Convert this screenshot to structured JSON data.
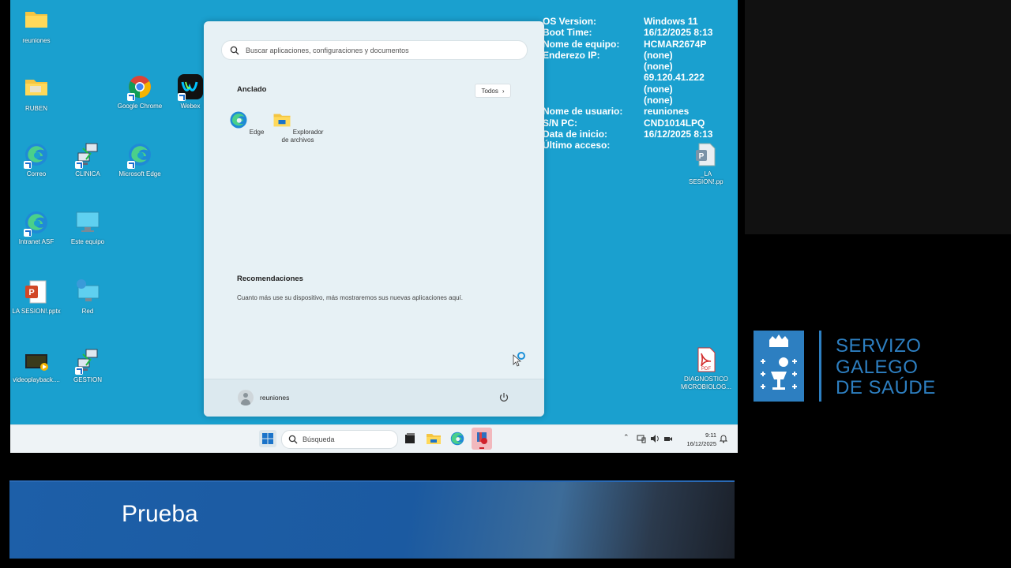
{
  "desktop": {
    "icons": [
      {
        "label": "reuniones",
        "icon": "folder-icon"
      },
      {
        "label": "RUBEN",
        "icon": "folder-icon"
      },
      {
        "label": "Google Chrome",
        "icon": "chrome-icon"
      },
      {
        "label": "Webex",
        "icon": "webex-icon"
      },
      {
        "label": "Correo",
        "icon": "edge-icon"
      },
      {
        "label": "CLINICA",
        "icon": "remote-desktop-icon"
      },
      {
        "label": "Microsoft Edge",
        "icon": "edge-icon"
      },
      {
        "label": "Intranet ASF",
        "icon": "edge-icon"
      },
      {
        "label": "Este equipo",
        "icon": "computer-icon"
      },
      {
        "label": "LA SESION!.pptx",
        "icon": "powerpoint-icon"
      },
      {
        "label": "Red",
        "icon": "network-icon"
      },
      {
        "label": "videoplayback....",
        "icon": "video-icon"
      },
      {
        "label": "GESTION",
        "icon": "remote-desktop-icon"
      },
      {
        "label": "_LA SESION!.pptx",
        "icon": "pptx-file-icon"
      },
      {
        "label": "DIAGNOSTICO MICROBIOLOG...",
        "icon": "pdf-icon"
      }
    ],
    "sysinfo": [
      {
        "key": "OS Version:",
        "value": "Windows 11"
      },
      {
        "key": "Boot Time:",
        "value": "16/12/2025 8:13"
      },
      {
        "key": "Nome de equipo:",
        "value": "HCMAR2674P"
      },
      {
        "key": "Enderezo IP:",
        "value": "(none)"
      },
      {
        "key": "",
        "value": "(none)"
      },
      {
        "key": "",
        "value": "69.120.41.222"
      },
      {
        "key": "",
        "value": "(none)"
      },
      {
        "key": "",
        "value": "(none)"
      },
      {
        "key": "Nome de usuario:",
        "value": "reuniones"
      },
      {
        "key": "S/N PC:",
        "value": "CND1014LPQ"
      },
      {
        "key": "Data de inicio:",
        "value": "16/12/2025 8:13"
      },
      {
        "key": "Último acceso:",
        "value": ""
      }
    ]
  },
  "start_menu": {
    "search_placeholder": "Buscar aplicaciones, configuraciones y documentos",
    "pinned_title": "Anclado",
    "all_button": "Todos",
    "pinned": [
      {
        "label": "Edge",
        "icon": "edge-icon"
      },
      {
        "label": "Explorador de archivos",
        "icon": "file-explorer-icon"
      }
    ],
    "recommended_title": "Recomendaciones",
    "recommended_hint": "Cuanto más use su dispositivo, más mostraremos sus nuevas aplicaciones aquí.",
    "user_name": "reuniones"
  },
  "taskbar": {
    "search_placeholder": "Búsqueda",
    "time": "9:11",
    "date": "16/12/2025"
  },
  "logo": {
    "line1": "SERVIZO",
    "line2": "GALEGO",
    "line3": "DE SAÚDE",
    "color": "#2d7fc1"
  },
  "banner": {
    "text": "Prueba"
  }
}
